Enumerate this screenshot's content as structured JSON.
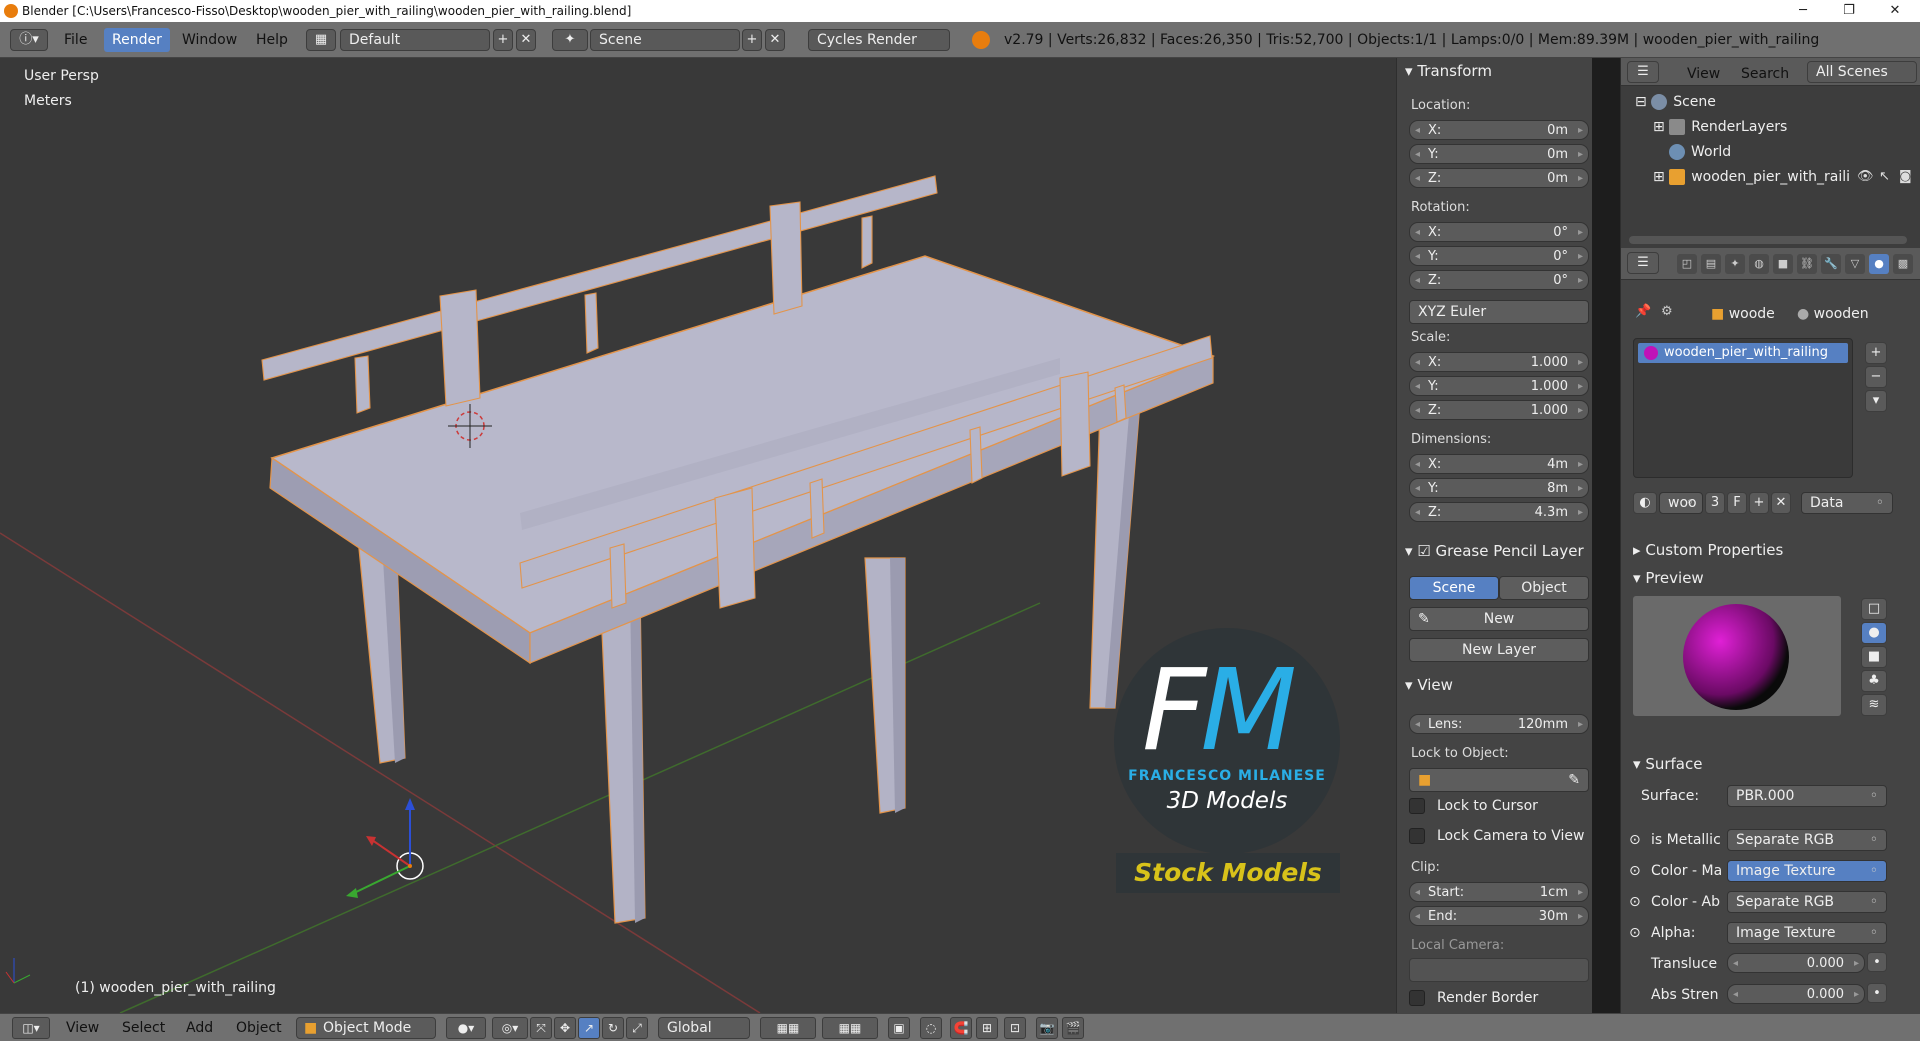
{
  "window": {
    "title": "Blender [C:\\Users\\Francesco-Fisso\\Desktop\\wooden_pier_with_railing\\wooden_pier_with_railing.blend]"
  },
  "info_header": {
    "menus": [
      "File",
      "Render",
      "Window",
      "Help"
    ],
    "layout": "Default",
    "scene": "Scene",
    "engine": "Cycles Render",
    "stats": "v2.79 | Verts:26,832 | Faces:26,350 | Tris:52,700 | Objects:1/1 | Lamps:0/0 | Mem:89.39M | wooden_pier_with_railing"
  },
  "viewport": {
    "perspective": "User Persp",
    "units": "Meters",
    "object_label": "(1) wooden_pier_with_railing",
    "watermark": {
      "initials_f": "F",
      "initials_m": "M",
      "name": "FRANCESCO MILANESE",
      "subtitle": "3D Models",
      "banner": "Stock Models"
    }
  },
  "properties_panel": {
    "transform_title": "Transform",
    "location_label": "Location:",
    "location": [
      {
        "axis": "X:",
        "value": "0m"
      },
      {
        "axis": "Y:",
        "value": "0m"
      },
      {
        "axis": "Z:",
        "value": "0m"
      }
    ],
    "rotation_label": "Rotation:",
    "rotation": [
      {
        "axis": "X:",
        "value": "0°"
      },
      {
        "axis": "Y:",
        "value": "0°"
      },
      {
        "axis": "Z:",
        "value": "0°"
      }
    ],
    "rotation_mode": "XYZ Euler",
    "scale_label": "Scale:",
    "scale": [
      {
        "axis": "X:",
        "value": "1.000"
      },
      {
        "axis": "Y:",
        "value": "1.000"
      },
      {
        "axis": "Z:",
        "value": "1.000"
      }
    ],
    "dimensions_label": "Dimensions:",
    "dimensions": [
      {
        "axis": "X:",
        "value": "4m"
      },
      {
        "axis": "Y:",
        "value": "8m"
      },
      {
        "axis": "Z:",
        "value": "4.3m"
      }
    ],
    "grease_pencil_title": "Grease Pencil Layer",
    "gp_scene": "Scene",
    "gp_object": "Object",
    "gp_new": "New",
    "gp_new_layer": "New Layer",
    "view_title": "View",
    "lens_label": "Lens:",
    "lens_value": "120mm",
    "lock_to_object": "Lock to Object:",
    "lock_to_cursor": "Lock to Cursor",
    "lock_camera": "Lock Camera to View",
    "clip_label": "Clip:",
    "clip_start_label": "Start:",
    "clip_start": "1cm",
    "clip_end_label": "End:",
    "clip_end": "30m",
    "local_camera": "Local Camera:",
    "render_border": "Render Border"
  },
  "outliner": {
    "menu_view": "View",
    "menu_search": "Search",
    "display_mode": "All Scenes",
    "items": [
      "Scene",
      "RenderLayers",
      "World",
      "wooden_pier_with_raili"
    ]
  },
  "material_panel": {
    "breadcrumb_1": "woode",
    "breadcrumb_2": "wooden",
    "material_slot": "wooden_pier_with_railing",
    "material_short": "woo",
    "users": "3",
    "fake_user": "F",
    "link": "Data",
    "custom_properties": "Custom Properties",
    "preview": "Preview",
    "surface_title": "Surface",
    "surface_label": "Surface:",
    "surface_value": "PBR.000",
    "inputs": [
      {
        "label": "is Metallic",
        "value": "Separate RGB"
      },
      {
        "label": "Color - Ma",
        "value": "Image Texture"
      },
      {
        "label": "Color - Ab",
        "value": "Separate RGB"
      },
      {
        "label": "Alpha:",
        "value": "Image Texture"
      }
    ],
    "translucency_label": "Transluce",
    "translucency_value": "0.000",
    "abs_strength_label": "Abs Stren",
    "abs_strength_value": "0.000"
  },
  "bottom_bar": {
    "view": "View",
    "select": "Select",
    "add": "Add",
    "object": "Object",
    "mode": "Object Mode",
    "orientation": "Global"
  }
}
